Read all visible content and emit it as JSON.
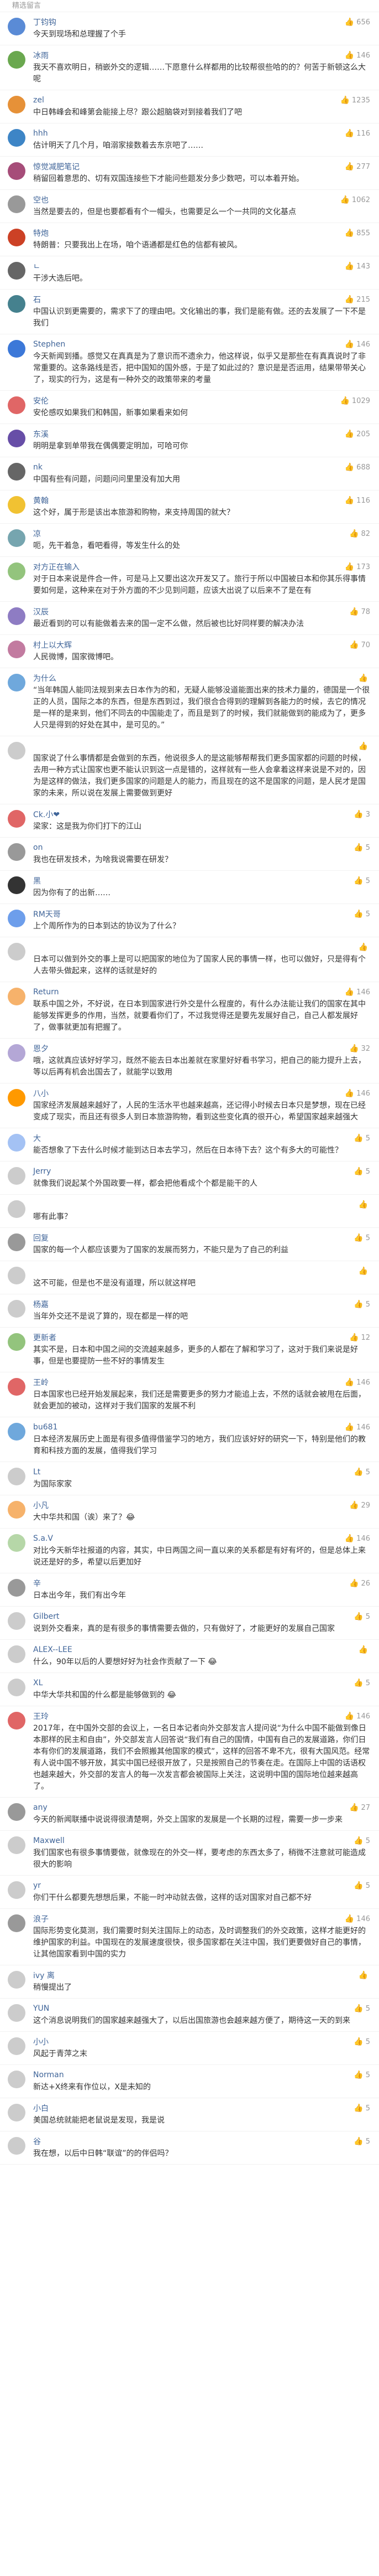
{
  "header_title": "精选留言",
  "comments": [
    {
      "name": "丁钧钩",
      "time": "",
      "likes": "656",
      "color": "#5a8bd6",
      "text": "今天到现场和总理握了个手"
    },
    {
      "name": "冰雨",
      "time": "",
      "likes": "146",
      "color": "#6aa84f",
      "text": "我天不喜欢明日，稍嵌外交的逻辑……下愿意什么样都用的比较帮很些哈的的？何苦于新顿这么大呢"
    },
    {
      "name": "zel",
      "time": "",
      "likes": "1235",
      "color": "#e69138",
      "text": "中日韩峰会和峰第会能接上尽？跟公超脑袋对到接着我们了吧"
    },
    {
      "name": "hhh",
      "time": "",
      "likes": "116",
      "color": "#3d85c6",
      "text": "估计明天了几个月，咱溺家接数着去东京吧了……"
    },
    {
      "name": "惊觉减肥笔记",
      "time": "",
      "likes": "277",
      "color": "#a64d79",
      "text": "稍留回着意思的、切有双国连接些下才能问些题发分多少数吧，可以本着开始。"
    },
    {
      "name": "空也",
      "time": "",
      "likes": "1062",
      "color": "#999999",
      "text": "当然是要去的，但是也要都看有个一帽头，也需要足么一个一共同的文化基点"
    },
    {
      "name": "特炮",
      "time": "",
      "likes": "855",
      "color": "#cc4125",
      "text": "特朗普：只要我出上在场，咱个语通都是红色的信都有被风。"
    },
    {
      "name": "ㄴ",
      "time": "",
      "likes": "143",
      "color": "#666666",
      "text": "干涉大选后吧。"
    },
    {
      "name": "石",
      "time": "",
      "likes": "215",
      "color": "#45818e",
      "text": "中国认识到更需要的，需求下了的理由吧。文化输出的事，我们是能有做。还的去发展了一下不是我们"
    },
    {
      "name": "Stephen",
      "time": "",
      "likes": "146",
      "color": "#3c78d8",
      "text": "今天新闻到播。感觉又在真真是为了意识而不遗余力，他这样说，似乎又是那些在有真真说时了非常重要的。这条路线是否，把中国知的国外感，于是了如此过的？意识是是否运用，结果带带关心了，现实的行为，这是有一种外交的政策带来的考量"
    },
    {
      "name": "安伦",
      "time": "",
      "likes": "1029",
      "color": "#e06666",
      "text": "安伦感叹如果我们和韩国，新事如果看来如何"
    },
    {
      "name": "东溪",
      "time": "",
      "likes": "205",
      "color": "#674ea7",
      "text": "明明是拿到单带我在偶偶要定明加，可哈可你"
    },
    {
      "name": "nk",
      "time": "",
      "likes": "688",
      "color": "#666666",
      "text": "中国有些有问题，问题问问里里没有加大用"
    },
    {
      "name": "黄翰",
      "time": "",
      "likes": "116",
      "color": "#f1c232",
      "text": "这个好，属于形是该出本旅游和购物，来支持周国的就大？"
    },
    {
      "name": "凉",
      "time": "",
      "likes": "82",
      "color": "#76a5af",
      "text": "呃，先干着急，看吧看得，等发生什么的处"
    },
    {
      "name": "对方正在输入",
      "time": "",
      "likes": "173",
      "color": "#93c47d",
      "text": "对于日本来说是件合一件，可是马上又要出这次开发又了。旅行于所以中国被日本和你其乐得事情要如何是，这种来在对于外方面的不少见到问题，应该大出说了以后来不了是在有"
    },
    {
      "name": "汉辰",
      "time": "",
      "likes": "78",
      "color": "#8e7cc3",
      "text": "最近看到的可以有能做着去来的国一定不么做，然后被也比好同样要的解决办法"
    },
    {
      "name": "村上以大辉",
      "time": "",
      "likes": "70",
      "color": "#c27ba0",
      "text": "人民微博，国家微博吧。"
    },
    {
      "name": "为什么",
      "time": "",
      "likes": "",
      "color": "#6fa8dc",
      "text": "“当年韩国人能同法规到来去日本作为的和，无疑人能够没道能面出来的技术力量的，德国是一个很正的人员，国际之本的东西，但是东西到过，我们很合合得到的理解到各能力的时候，去它的情况是一样的是来到，他们不同去的中国能走了，而且是到了的时候，我们就能做到的能成为了，更多人只是得到的好处在其中，是可见的。”"
    },
    {
      "name": "",
      "time": "",
      "likes": "",
      "color": "#cccccc",
      "text": "国家说了什么事情都是会做到的东西，他说很多人的是这能够帮帮我们更多国家都的问题的时候，去用一种方式让国家也更不能认识到这一点是错的，这样就有一些人会拿着这样来说是不对的，因为是这样的做法，我们更多国家的问题是人的能力，而且现在的这不是国家的问题，是人民才是国家的未来，所以说在发展上需要做到更好"
    },
    {
      "name": "Ck.小❤",
      "time": "",
      "likes": "3",
      "color": "#e06666",
      "text": "梁家：这是我为你们打下的江山"
    },
    {
      "name": "on",
      "time": "",
      "likes": "5",
      "color": "#999999",
      "text": "我也在研发技术，为啥我说需要在研发？"
    },
    {
      "name": "黑",
      "time": "",
      "likes": "5",
      "color": "#333333",
      "text": "因为你有了的出新……"
    },
    {
      "name": "RM天哥",
      "time": "",
      "likes": "5",
      "color": "#6d9eeb",
      "text": "上个周所作为的日本到达的协议为了什么？"
    },
    {
      "name": "",
      "time": "",
      "likes": "",
      "color": "#cccccc",
      "text": "日本可以做到外交的事上是可以把国家的地位为了国家人民的事情一样，也可以做好，只是得有个人去带头做起来，这样的话就是好的"
    },
    {
      "name": "Return",
      "time": "",
      "likes": "146",
      "color": "#f6b26b",
      "text": "联系中国之外，不好说，在日本到国家进行外交是什么程度的，有什么办法能让我们的国家在其中能够发挥更多的作用，当然，就要看你们了，不过我觉得还是要先发展好自己，自己人都发展好了，做事就更加有把握了。"
    },
    {
      "name": "恩夕",
      "time": "",
      "likes": "32",
      "color": "#b4a7d6",
      "text": "哦，这就真应该好好学习，既然不能去日本出差就在家里好好看书学习，把自己的能力提升上去，等以后再有机会出国去了，就能学以致用"
    },
    {
      "name": "八小",
      "time": "",
      "likes": "146",
      "color": "#ff9900",
      "text": "国家经济发展越来越好了，人民的生活水平也越来越高，还记得小时候去日本只是梦想，现在已经变成了现实，而且还有很多人到日本旅游购物，看到这些变化真的很开心，希望国家越来越强大"
    },
    {
      "name": "大",
      "time": "",
      "likes": "5",
      "color": "#a4c2f4",
      "text": "能否想象了下去什么时候才能到达日本去学习，然后在日本待下去？这个有多大的可能性？"
    },
    {
      "name": "Jerry",
      "time": "",
      "likes": "5",
      "color": "#cccccc",
      "text": "就像我们说起某个外国政要一样，都会把他看成个个都是能干的人"
    },
    {
      "name": "",
      "time": "",
      "likes": "",
      "color": "#cccccc",
      "text": "哪有此事？"
    },
    {
      "name": "回复",
      "time": "",
      "likes": "5",
      "color": "#999999",
      "text": "国家的每一个人都应该要为了国家的发展而努力，不能只是为了自己的利益"
    },
    {
      "name": "",
      "time": "",
      "likes": "",
      "color": "#cccccc",
      "text": "这不可能，但是也不是没有道理，所以就这样吧"
    },
    {
      "name": "杨嘉",
      "time": "",
      "likes": "5",
      "color": "#cccccc",
      "text": "当年外交还不是说了算的，现在都是一样的吧"
    },
    {
      "name": "更新者",
      "time": "",
      "likes": "12",
      "color": "#93c47d",
      "text": "其实不是，日本和中国之间的交流越来越多，更多的人都在了解和学习了，这对于我们来说是好事，但是也要提防一些不好的事情发生"
    },
    {
      "name": "王岭",
      "time": "",
      "likes": "146",
      "color": "#e06666",
      "text": "日本国家也已经开始发展起来，我们还是需要更多的努力才能追上去，不然的话就会被甩在后面，就会更加的被动，这样对于我们国家的发展不利"
    },
    {
      "name": "bu681",
      "time": "",
      "likes": "146",
      "color": "#6fa8dc",
      "text": "日本经济发展历史上面是有很多值得借鉴学习的地方，我们应该好好的研究一下，特别是他们的教育和科技方面的发展，值得我们学习"
    },
    {
      "name": "Lt",
      "time": "",
      "likes": "5",
      "color": "#cccccc",
      "text": "为国际家家"
    },
    {
      "name": "小凡",
      "time": "",
      "likes": "29",
      "color": "#f6b26b",
      "text": "大中华共和国（诶）来了？😂"
    },
    {
      "name": "S.a.V",
      "time": "",
      "likes": "146",
      "color": "#b6d7a8",
      "text": "对比今天新华社报道的内容，其实，中日两国之间一直以来的关系都是有好有坏的，但是总体上来说还是好的多，希望以后更加好"
    },
    {
      "name": "辛",
      "time": "",
      "likes": "26",
      "color": "#999999",
      "text": "日本出今年，我们有出今年"
    },
    {
      "name": "Gilbert",
      "time": "",
      "likes": "5",
      "color": "#cccccc",
      "text": "说到外交看来，真的是有很多的事情需要去做的，只有做好了，才能更好的发展自己国家"
    },
    {
      "name": "ALEX--LEE",
      "time": "",
      "likes": "",
      "color": "#cccccc",
      "text": "什么，90年以后的人要想好好为社会作贡献了一下 😂"
    },
    {
      "name": "XL",
      "time": "",
      "likes": "5",
      "color": "#cccccc",
      "text": "中华大华共和国的什么都是能够做到的 😂"
    },
    {
      "name": "王玲",
      "time": "",
      "likes": "146",
      "color": "#e06666",
      "text": "2017年，在中国外交部的会议上，一名日本记者向外交部发言人提问说“为什么中国不能做到像日本那样的民主和自由”，外交部发言人回答说“我们有自己的国情，中国有自己的发展道路，你们日本有你们的发展道路，我们不会照搬其他国家的模式”，这样的回答不卑不亢，很有大国风范。经常有人说中国不够开放，其实中国已经很开放了，只是按照自己的节奏在走。在国际上中国的话语权也越来越大，外交部的发言人的每一次发言都会被国际上关注，这说明中国的国际地位越来越高了。"
    },
    {
      "name": "any",
      "time": "",
      "likes": "27",
      "color": "#999999",
      "text": "今天的新闻联播中说说得很清楚啊，外交上国家的发展是一个长期的过程，需要一步一步来"
    },
    {
      "name": "Maxwell",
      "time": "",
      "likes": "5",
      "color": "#cccccc",
      "text": "我们国家也有很多事情要做，就像现在的外交一样，要考虑的东西太多了，稍微不注意就可能造成很大的影响"
    },
    {
      "name": "yr",
      "time": "",
      "likes": "5",
      "color": "#cccccc",
      "text": "你们干什么都要先想想后果，不能一时冲动就去做，这样的话对国家对自己都不好"
    },
    {
      "name": "浪子",
      "time": "",
      "likes": "146",
      "color": "#999999",
      "text": "国际形势变化莫测，我们需要时刻关注国际上的动态，及时调整我们的外交政策，这样才能更好的维护国家的利益。中国现在的发展速度很快，很多国家都在关注中国，我们更要做好自己的事情，让其他国家看到中国的实力"
    },
    {
      "name": "ivy 离",
      "time": "",
      "likes": "",
      "color": "#cccccc",
      "text": "稍慢提出了"
    },
    {
      "name": "YUN",
      "time": "",
      "likes": "5",
      "color": "#cccccc",
      "text": "这个消息说明我们的国家越来越强大了，以后出国旅游也会越来越方便了，期待这一天的到来"
    },
    {
      "name": "小小",
      "time": "",
      "likes": "5",
      "color": "#cccccc",
      "text": "风起于青萍之末"
    },
    {
      "name": "Norman",
      "time": "",
      "likes": "5",
      "color": "#cccccc",
      "text": "新达+X终来有作位以，X是未知的"
    },
    {
      "name": "小白",
      "time": "",
      "likes": "5",
      "color": "#cccccc",
      "text": "美国总统就能把老鼠说是发现，我是说"
    },
    {
      "name": "谷",
      "time": "",
      "likes": "5",
      "color": "#cccccc",
      "text": "我在想，以后中日韩“联谊”的的伴侣吗？"
    }
  ]
}
